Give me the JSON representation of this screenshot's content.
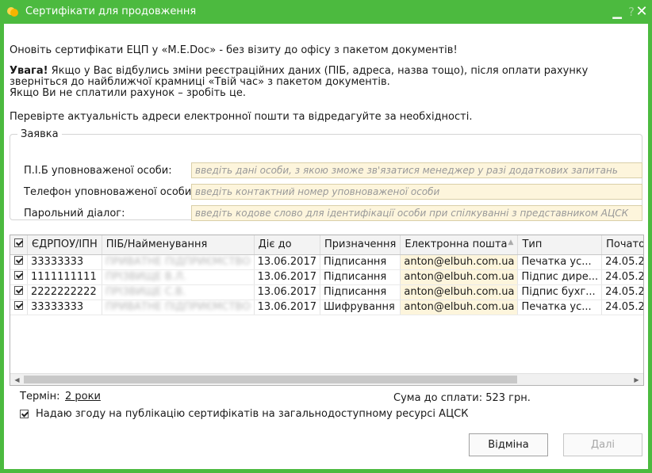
{
  "window": {
    "title": "Сертифікати для продовження",
    "accent": "#4cba3f"
  },
  "intro": "Оновіть сертифікати ЕЦП у «M.E.Doc» - без візиту до офісу з пакетом документів!",
  "warning": {
    "bold": "Увага!",
    "text1": " Якщо у Вас відбулись зміни реєстраційних даних (ПІБ, адреса, назва тощо), після оплати рахунку зверніться до найближчої крамниці «Твій час» з пакетом документів.",
    "text2": "Якщо Ви не сплатили рахунок – зробіть це."
  },
  "check_email": "Перевірте актуальність адреси електронної пошти та відредагуйте за необхідності.",
  "form": {
    "legend": "Заявка",
    "pib_label": "П.І.Б уповноваженої особи:",
    "pib_placeholder": "введіть дані особи, з якою зможе зв'язатися менеджер у разі додаткових запитань",
    "phone_label": "Телефон уповноваженої особи:",
    "phone_placeholder": "введіть контактний номер уповноваженої особи",
    "password_label": "Парольний діалог:",
    "password_placeholder": "введіть кодове слово для ідентифікації особи при спілкуванні з представником АЦСК"
  },
  "table": {
    "columns": [
      "ЄДРПОУ/ІПН",
      "ПІБ/Найменування",
      "Діє до",
      "Призначення",
      "Електронна пошта",
      "Тип",
      "Початок"
    ],
    "rows": [
      {
        "checked": true,
        "code": "33333333",
        "name": "ПРИВАТНЕ ПІДПРИЄМСТВО",
        "valid": "13.06.2017",
        "purpose": "Підписання",
        "email": "anton@elbuh.com.ua",
        "type": "Печатка ус...",
        "start": "24.05.2"
      },
      {
        "checked": true,
        "code": "1111111111",
        "name": "ПРІЗВИЩЕ В.Л.",
        "valid": "13.06.2017",
        "purpose": "Підписання",
        "email": "anton@elbuh.com.ua",
        "type": "Підпис дире...",
        "start": "24.05.2"
      },
      {
        "checked": true,
        "code": "2222222222",
        "name": "ПРІЗВИЩЕ С.В.",
        "valid": "13.06.2017",
        "purpose": "Підписання",
        "email": "anton@elbuh.com.ua",
        "type": "Підпис бухг...",
        "start": "24.05.2"
      },
      {
        "checked": true,
        "code": "33333333",
        "name": "ПРИВАТНЕ ПІДПРИЄМСТВО",
        "valid": "13.06.2017",
        "purpose": "Шифрування",
        "email": "anton@elbuh.com.ua",
        "type": "Печатка ус...",
        "start": "24.05.2"
      }
    ]
  },
  "footer": {
    "term_label": "Термін:",
    "term_value": "2 роки",
    "sum": "Сума до сплати: 523 грн.",
    "agree": "Надаю згоду на публікацію сертифікатів на загальнодоступному ресурсі АЦСК",
    "agree_checked": true
  },
  "buttons": {
    "cancel": "Відміна",
    "next": "Далі"
  }
}
